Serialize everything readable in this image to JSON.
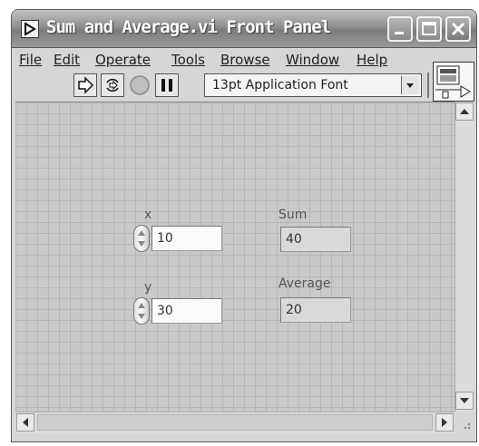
{
  "window": {
    "title": "Sum and Average.vi Front Panel",
    "icons": {
      "title": "labview-run-icon",
      "minimize": "minimize-icon",
      "maximize": "maximize-icon",
      "close": "close-icon"
    }
  },
  "menu": {
    "items": [
      {
        "label": "File"
      },
      {
        "label": "Edit"
      },
      {
        "label": "Operate"
      },
      {
        "label": "Tools"
      },
      {
        "label": "Browse"
      },
      {
        "label": "Window"
      },
      {
        "label": "Help"
      }
    ]
  },
  "toolbar": {
    "buttons": [
      {
        "icon": "run-arrow-icon"
      },
      {
        "icon": "run-continuously-icon"
      },
      {
        "icon": "abort-icon"
      },
      {
        "icon": "pause-icon"
      }
    ],
    "font": "13pt Application Font"
  },
  "panel": {
    "controls": [
      {
        "label": "x",
        "value": "10"
      },
      {
        "label": "y",
        "value": "30"
      }
    ],
    "indicators": [
      {
        "label": "Sum",
        "value": "40"
      },
      {
        "label": "Average",
        "value": "20"
      }
    ]
  },
  "colors": {
    "title_bar": "#8f8f8f",
    "canvas": "#c9c9c9",
    "grid": "#b6b6b6"
  }
}
